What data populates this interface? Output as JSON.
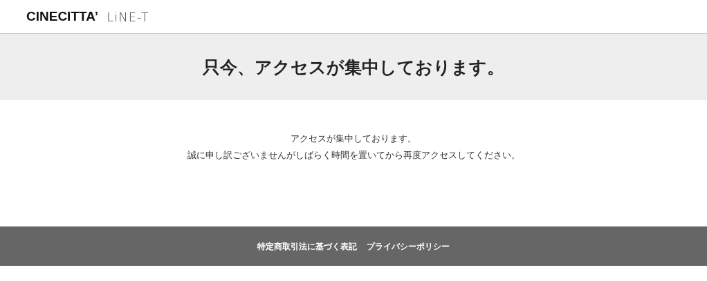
{
  "header": {
    "logo_primary": "CINECITTA’",
    "logo_secondary": "LiNE-T"
  },
  "banner": {
    "title": "只今、アクセスが集中しております。"
  },
  "message": [
    "アクセスが集中しております。",
    "誠に申し訳ございませんがしばらく時間を置いてから再度アクセスしてください。"
  ],
  "footer": {
    "links": [
      "特定商取引法に基づく表記",
      "プライバシーポリシー"
    ]
  }
}
